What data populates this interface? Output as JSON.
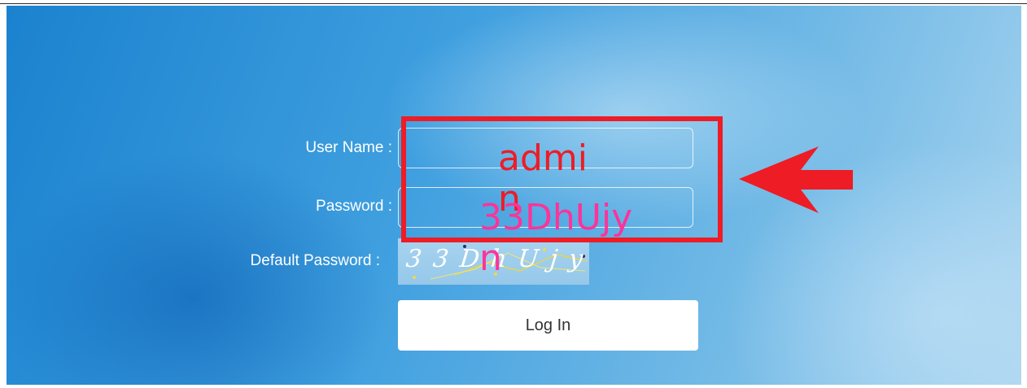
{
  "login_form": {
    "username_label": "User Name :",
    "password_label": "Password :",
    "default_password_label": "Default Password :",
    "username_value": "",
    "password_value": "",
    "captcha_text": "33DhUjyn",
    "login_button_label": "Log In"
  },
  "annotations": {
    "typed_username": "admin",
    "typed_password": "33DhUjyn",
    "highlight_color": "#ee1c25",
    "password_overlay_color": "#ff3399",
    "arrow_icon": "left-arrow-icon"
  }
}
